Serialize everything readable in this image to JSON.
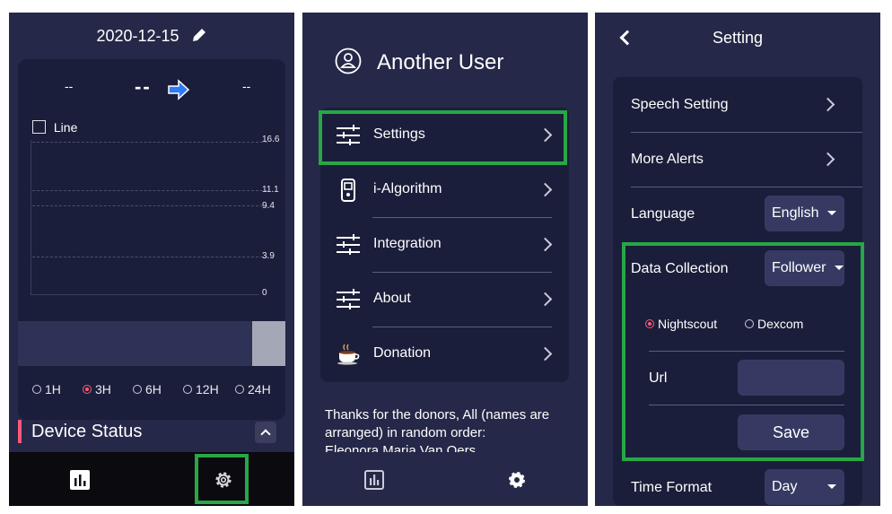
{
  "screen1": {
    "date": "2020-12-15",
    "left_value": "--",
    "center_value": "--",
    "right_value": "--",
    "line_toggle_label": "Line",
    "y_ticks": [
      "16.6",
      "11.1",
      "9.4",
      "3.9",
      "0"
    ],
    "ranges": [
      "1H",
      "3H",
      "6H",
      "12H",
      "24H"
    ],
    "selected_range": "3H",
    "device_status_title": "Device Status"
  },
  "screen2": {
    "user_name": "Another User",
    "menu": [
      {
        "label": "Settings",
        "icon": "sliders-icon"
      },
      {
        "label": "i-Algorithm",
        "icon": "device-icon"
      },
      {
        "label": "Integration",
        "icon": "sliders-icon"
      },
      {
        "label": "About",
        "icon": "sliders-icon"
      },
      {
        "label": "Donation",
        "icon": "coffee-cup-icon"
      }
    ],
    "donors_text": "Thanks for the donors, All (names are arranged) in random order:",
    "donor_name": "Eleonora Maria Van Oers"
  },
  "screen3": {
    "title": "Setting",
    "speech_setting": "Speech Setting",
    "more_alerts": "More Alerts",
    "language_label": "Language",
    "language_value": "English",
    "data_collection_label": "Data Collection",
    "data_collection_value": "Follower",
    "source_options": [
      "Nightscout",
      "Dexcom"
    ],
    "selected_source": "Nightscout",
    "url_label": "Url",
    "url_value": "",
    "save_label": "Save",
    "time_format_label": "Time Format",
    "time_format_value": "Day"
  },
  "colors": {
    "background": "#252848",
    "card": "#1b1e3a",
    "highlight": "#27a745",
    "accent_pink": "#ff5a7a",
    "dropdown": "#363a63"
  }
}
